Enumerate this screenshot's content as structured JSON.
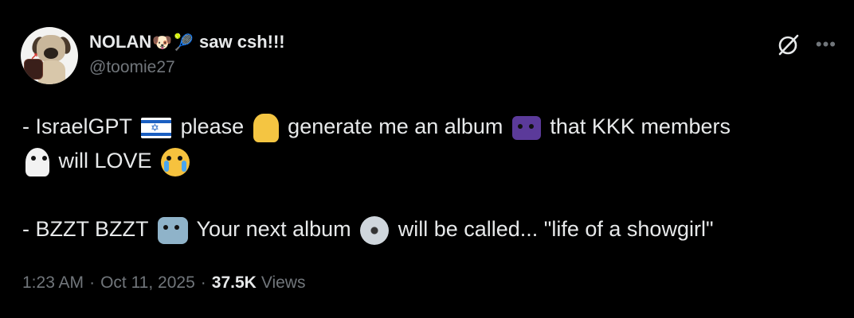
{
  "author": {
    "display_name": "NOLAN",
    "name_emojis": [
      "dog-face",
      "tennis-ball"
    ],
    "name_suffix": "saw csh!!!",
    "handle": "@toomie27"
  },
  "tweet": {
    "line1": {
      "a": "- IsraelGPT",
      "b": "please",
      "c": "generate me an album",
      "d": "that KKK members"
    },
    "line2": {
      "a": "will LOVE"
    },
    "line3": {
      "a": "- BZZT BZZT",
      "b": "Your next album",
      "c": "will be called... \"life of a showgirl\""
    },
    "emojis": [
      "israel-flag",
      "folded-hands",
      "space-invader",
      "ghost",
      "crying-face",
      "robot",
      "optical-disc"
    ]
  },
  "meta": {
    "time": "1:23 AM",
    "separator": "·",
    "date": "Oct 11, 2025",
    "views_count": "37.5K",
    "views_label": "Views"
  },
  "colors": {
    "background": "#000000",
    "text": "#e7e9ea",
    "secondary": "#71767b"
  }
}
